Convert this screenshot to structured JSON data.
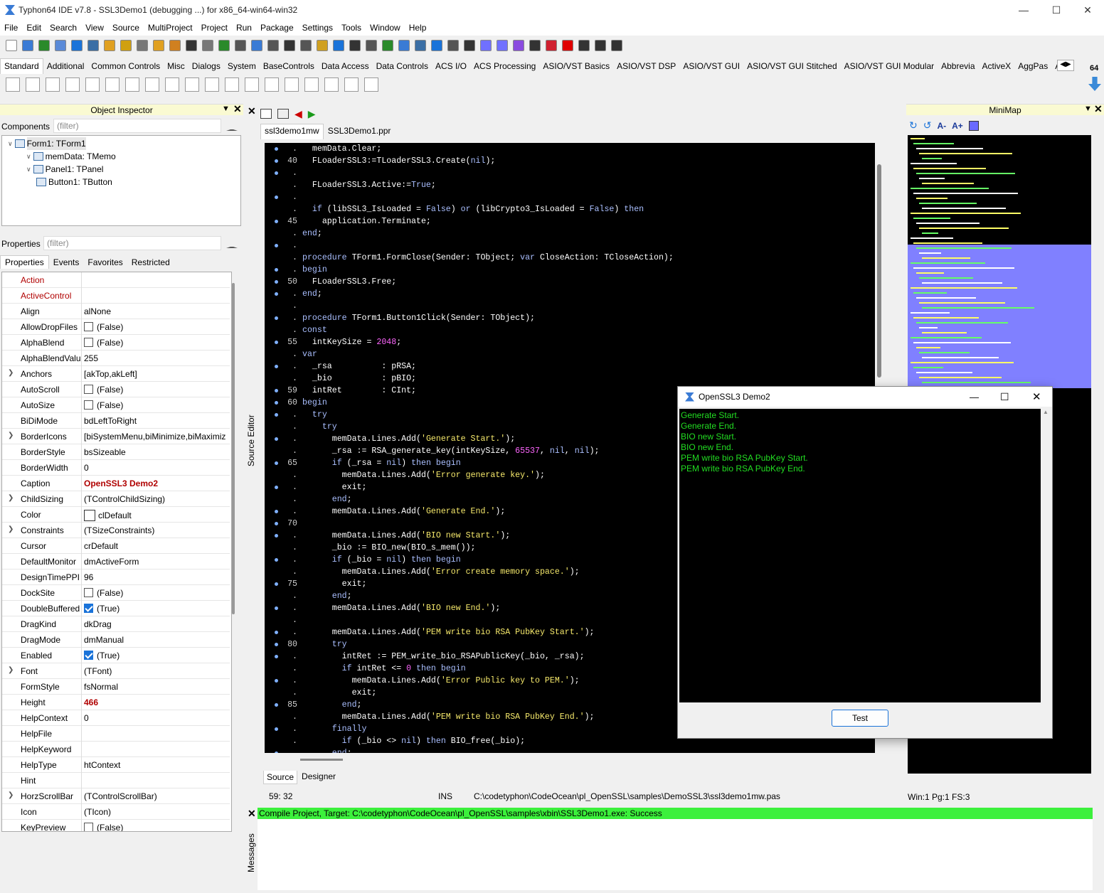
{
  "window": {
    "title": "Typhon64 IDE v7.8 - SSL3Demo1 (debugging ...) for x86_64-win64-win32"
  },
  "menu": [
    "File",
    "Edit",
    "Search",
    "View",
    "Source",
    "MultiProject",
    "Project",
    "Run",
    "Package",
    "Settings",
    "Tools",
    "Window",
    "Help"
  ],
  "palette": {
    "tabs": [
      "Standard",
      "Additional",
      "Common Controls",
      "Misc",
      "Dialogs",
      "System",
      "BaseControls",
      "Data Access",
      "Data Controls",
      "ACS I/O",
      "ACS Processing",
      "ASIO/VST Basics",
      "ASIO/VST DSP",
      "ASIO/VST GUI",
      "ASIO/VST GUI Stitched",
      "ASIO/VST GUI Modular",
      "Abbrevia",
      "ActiveX",
      "AggPas",
      "Astro"
    ],
    "badge": "64"
  },
  "object_inspector": {
    "title": "Object Inspector",
    "components_label": "Components",
    "filter_placeholder": "(filter)",
    "properties_label": "Properties",
    "tree": [
      {
        "label": "Form1: TForm1",
        "depth": 0
      },
      {
        "label": "memData: TMemo",
        "depth": 1
      },
      {
        "label": "Panel1: TPanel",
        "depth": 1
      },
      {
        "label": "Button1: TButton",
        "depth": 2
      }
    ],
    "tabs": [
      "Properties",
      "Events",
      "Favorites",
      "Restricted"
    ],
    "props": [
      {
        "name": "Action",
        "value": "",
        "hl": "red"
      },
      {
        "name": "ActiveControl",
        "value": "",
        "hl": "red"
      },
      {
        "name": "Align",
        "value": "alNone"
      },
      {
        "name": "AllowDropFiles",
        "value": "(False)",
        "cb": "off"
      },
      {
        "name": "AlphaBlend",
        "value": "(False)",
        "cb": "off"
      },
      {
        "name": "AlphaBlendValu",
        "value": "255"
      },
      {
        "name": "Anchors",
        "value": "[akTop,akLeft]",
        "exp": true
      },
      {
        "name": "AutoScroll",
        "value": "(False)",
        "cb": "off"
      },
      {
        "name": "AutoSize",
        "value": "(False)",
        "cb": "off"
      },
      {
        "name": "BiDiMode",
        "value": "bdLeftToRight"
      },
      {
        "name": "BorderIcons",
        "value": "[biSystemMenu,biMinimize,biMaximiz",
        "exp": true
      },
      {
        "name": "BorderStyle",
        "value": "bsSizeable"
      },
      {
        "name": "BorderWidth",
        "value": "0"
      },
      {
        "name": "Caption",
        "value": "OpenSSL3 Demo2",
        "bold": true
      },
      {
        "name": "ChildSizing",
        "value": "(TControlChildSizing)",
        "exp": true
      },
      {
        "name": "Color",
        "value": "clDefault",
        "color": true
      },
      {
        "name": "Constraints",
        "value": "(TSizeConstraints)",
        "exp": true
      },
      {
        "name": "Cursor",
        "value": "crDefault"
      },
      {
        "name": "DefaultMonitor",
        "value": "dmActiveForm"
      },
      {
        "name": "DesignTimePPI",
        "value": "96"
      },
      {
        "name": "DockSite",
        "value": "(False)",
        "cb": "off"
      },
      {
        "name": "DoubleBuffered",
        "value": "(True)",
        "cb": "on"
      },
      {
        "name": "DragKind",
        "value": "dkDrag"
      },
      {
        "name": "DragMode",
        "value": "dmManual"
      },
      {
        "name": "Enabled",
        "value": "(True)",
        "cb": "on"
      },
      {
        "name": "Font",
        "value": "(TFont)",
        "exp": true
      },
      {
        "name": "FormStyle",
        "value": "fsNormal"
      },
      {
        "name": "Height",
        "value": "466",
        "bold": true
      },
      {
        "name": "HelpContext",
        "value": "0"
      },
      {
        "name": "HelpFile",
        "value": ""
      },
      {
        "name": "HelpKeyword",
        "value": ""
      },
      {
        "name": "HelpType",
        "value": "htContext"
      },
      {
        "name": "Hint",
        "value": ""
      },
      {
        "name": "HorzScrollBar",
        "value": "(TControlScrollBar)",
        "exp": true
      },
      {
        "name": "Icon",
        "value": "(TIcon)"
      },
      {
        "name": "KeyPreview",
        "value": "(False)",
        "cb": "off"
      }
    ]
  },
  "editor": {
    "tabs": [
      "ssl3demo1mw",
      "SSL3Demo1.ppr"
    ],
    "vertical_label": "Source Editor",
    "bottom_tabs": [
      "Source",
      "Designer"
    ],
    "lines": [
      {
        "n": ".",
        "t": "  memData.Clear;"
      },
      {
        "n": "40",
        "t": "  FLoaderSSL3:=TLoaderSSL3.Create(nil);"
      },
      {
        "n": ".",
        "t": ""
      },
      {
        "n": ".",
        "t": "  FLoaderSSL3.Active:=True;"
      },
      {
        "n": ".",
        "t": ""
      },
      {
        "n": ".",
        "t": "  if (libSSL3_IsLoaded = False) or (libCrypto3_IsLoaded = False) then"
      },
      {
        "n": "45",
        "t": "    application.Terminate;"
      },
      {
        "n": ".",
        "t": "end;"
      },
      {
        "n": ".",
        "t": ""
      },
      {
        "n": ".",
        "t": "procedure TForm1.FormClose(Sender: TObject; var CloseAction: TCloseAction);"
      },
      {
        "n": ".",
        "t": "begin"
      },
      {
        "n": "50",
        "t": "  FLoaderSSL3.Free;"
      },
      {
        "n": ".",
        "t": "end;"
      },
      {
        "n": ".",
        "t": ""
      },
      {
        "n": ".",
        "t": "procedure TForm1.Button1Click(Sender: TObject);"
      },
      {
        "n": ".",
        "t": "const"
      },
      {
        "n": "55",
        "t": "  intKeySize = 2048;"
      },
      {
        "n": ".",
        "t": "var"
      },
      {
        "n": ".",
        "t": "  _rsa          : pRSA;"
      },
      {
        "n": ".",
        "t": "  _bio          : pBIO;"
      },
      {
        "n": "59",
        "t": "  intRet        : CInt;"
      },
      {
        "n": "60",
        "t": "begin"
      },
      {
        "n": ".",
        "t": "  try"
      },
      {
        "n": ".",
        "t": "    try"
      },
      {
        "n": ".",
        "t": "      memData.Lines.Add('Generate Start.');"
      },
      {
        "n": ".",
        "t": "      _rsa := RSA_generate_key(intKeySize, 65537, nil, nil);"
      },
      {
        "n": "65",
        "t": "      if (_rsa = nil) then begin"
      },
      {
        "n": ".",
        "t": "        memData.Lines.Add('Error generate key.');"
      },
      {
        "n": ".",
        "t": "        exit;"
      },
      {
        "n": ".",
        "t": "      end;"
      },
      {
        "n": ".",
        "t": "      memData.Lines.Add('Generate End.');"
      },
      {
        "n": "70",
        "t": ""
      },
      {
        "n": ".",
        "t": "      memData.Lines.Add('BIO new Start.');"
      },
      {
        "n": ".",
        "t": "      _bio := BIO_new(BIO_s_mem());"
      },
      {
        "n": ".",
        "t": "      if (_bio = nil) then begin"
      },
      {
        "n": ".",
        "t": "        memData.Lines.Add('Error create memory space.');"
      },
      {
        "n": "75",
        "t": "        exit;"
      },
      {
        "n": ".",
        "t": "      end;"
      },
      {
        "n": ".",
        "t": "      memData.Lines.Add('BIO new End.');"
      },
      {
        "n": ".",
        "t": ""
      },
      {
        "n": ".",
        "t": "      memData.Lines.Add('PEM write bio RSA PubKey Start.');"
      },
      {
        "n": "80",
        "t": "      try"
      },
      {
        "n": ".",
        "t": "        intRet := PEM_write_bio_RSAPublicKey(_bio, _rsa);"
      },
      {
        "n": ".",
        "t": "        if intRet <= 0 then begin"
      },
      {
        "n": ".",
        "t": "          memData.Lines.Add('Error Public key to PEM.');"
      },
      {
        "n": ".",
        "t": "          exit;"
      },
      {
        "n": "85",
        "t": "        end;"
      },
      {
        "n": ".",
        "t": "        memData.Lines.Add('PEM write bio RSA PubKey End.');"
      },
      {
        "n": ".",
        "t": "      finally"
      },
      {
        "n": ".",
        "t": "        if (_bio <> nil) then BIO_free(_bio);"
      },
      {
        "n": ".",
        "t": "      end;"
      }
    ]
  },
  "minimap": {
    "title": "MiniMap",
    "status": "Win:1 Pg:1  FS:3"
  },
  "status": {
    "pos": "59: 32",
    "mode": "INS",
    "file": "C:\\codetyphon\\CodeOcean\\pl_OpenSSL\\samples\\DemoSSL3\\ssl3demo1mw.pas"
  },
  "messages": {
    "label": "Messages",
    "text": "Compile Project, Target: C:\\codetyphon\\CodeOcean\\pl_OpenSSL\\samples\\xbin\\SSL3Demo1.exe: Success"
  },
  "dialog": {
    "title": "OpenSSL3 Demo2",
    "memo": [
      "Generate Start.",
      "Generate End.",
      "BIO new Start.",
      "BIO new End.",
      "PEM write bio RSA PubKey Start.",
      "PEM write bio RSA PubKey End."
    ],
    "button": "Test"
  },
  "colors": {
    "msg_success": "#3cf03c",
    "panel_header": "#fafad2",
    "accent": "#1a73d9"
  }
}
